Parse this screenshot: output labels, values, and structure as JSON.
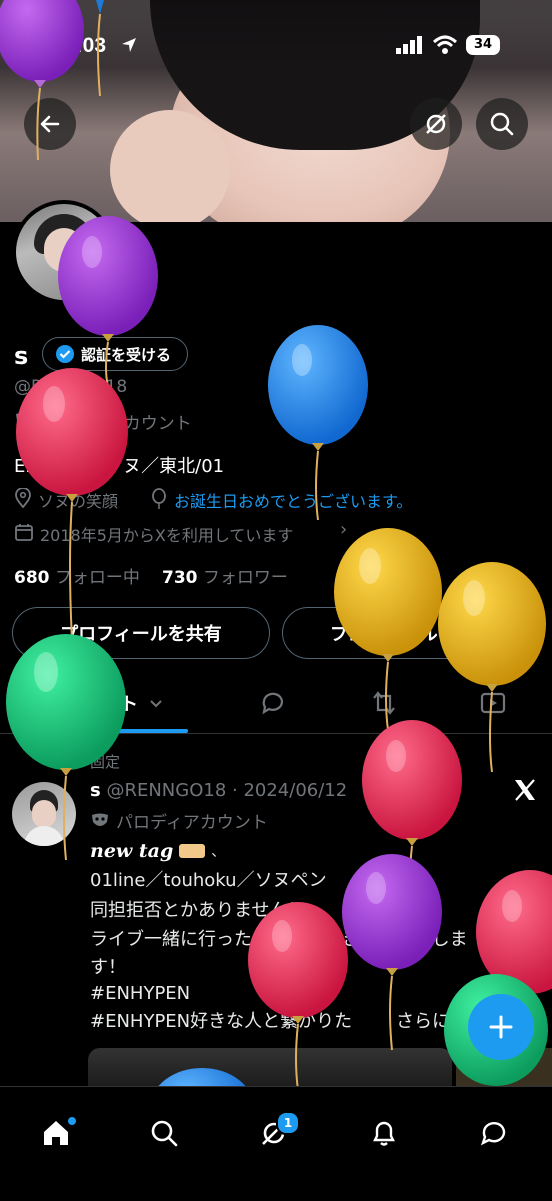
{
  "status_bar": {
    "time": "0:03",
    "battery": "34"
  },
  "profile": {
    "name": "s",
    "verify_label": "認証を受ける",
    "handle": "@RENNGO18",
    "parody_label": "パロディアカウント",
    "bio": "ENHYPEN/ソヌ／東北/01",
    "location": "ソヌの笑顔",
    "birthday_text": "お誕生日おめでとうございます。",
    "joined": "2018年5月からXを利用しています",
    "following_count": "680",
    "following_label": "フォロー中",
    "followers_count": "730",
    "followers_label": "フォロワー"
  },
  "actions": {
    "share": "プロフィールを共有",
    "edit": "プロフィールを編集"
  },
  "tabs": {
    "posts": "ポスト"
  },
  "pinned_post": {
    "pinned_label": "固定",
    "author": "s",
    "meta": "@RENNGO18 · 2024/06/12",
    "parody_label": "パロディアカウント",
    "tag_line": "new tag",
    "tag_suffix": "、",
    "line1": "01line／touhoku／ソヌペン",
    "line2": "同担拒否とかありません！",
    "line3": "ライブ一緒に行ったりオタ活できる人募集しま",
    "line4": "す！",
    "hashtag1": "#ENHYPEN",
    "hashtag2": "#ENHYPEN好きな人と繋がりた",
    "more": "さらに表"
  },
  "nav": {
    "notification_badge": "1"
  },
  "colors": {
    "accent": "#1d9bf0",
    "background": "#000000",
    "muted": "#71767b"
  }
}
